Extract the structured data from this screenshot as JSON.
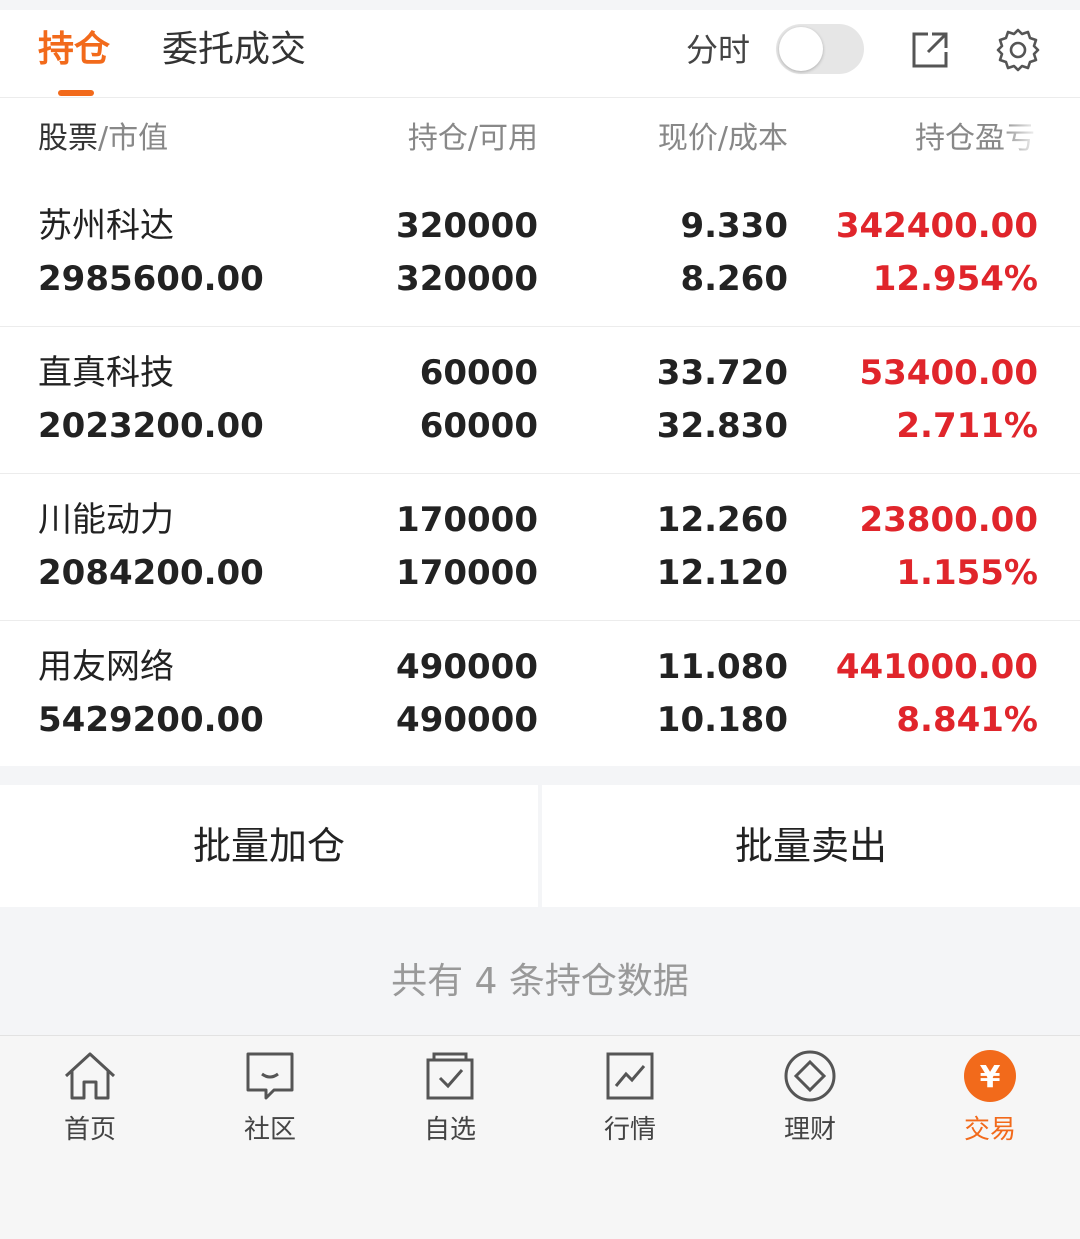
{
  "header": {
    "tab_positions": "持仓",
    "tab_orders": "委托成交",
    "fenshi_label": "分时",
    "fenshi_toggle_on": false
  },
  "columns": {
    "c1_main": "股票",
    "c1_sub": "/市值",
    "c2_main": "持仓",
    "c2_sub": "/可用",
    "c3_main": "现价",
    "c3_sub": "/成本",
    "c4_main": "持仓盈亏"
  },
  "holdings": [
    {
      "name": "苏州科达",
      "market_value": "2985600.00",
      "quantity": "320000",
      "available": "320000",
      "price": "9.330",
      "cost": "8.260",
      "pl_amount": "342400.00",
      "pl_percent": "12.954%"
    },
    {
      "name": "直真科技",
      "market_value": "2023200.00",
      "quantity": "60000",
      "available": "60000",
      "price": "33.720",
      "cost": "32.830",
      "pl_amount": "53400.00",
      "pl_percent": "2.711%"
    },
    {
      "name": "川能动力",
      "market_value": "2084200.00",
      "quantity": "170000",
      "available": "170000",
      "price": "12.260",
      "cost": "12.120",
      "pl_amount": "23800.00",
      "pl_percent": "1.155%"
    },
    {
      "name": "用友网络",
      "market_value": "5429200.00",
      "quantity": "490000",
      "available": "490000",
      "price": "11.080",
      "cost": "10.180",
      "pl_amount": "441000.00",
      "pl_percent": "8.841%"
    }
  ],
  "actions": {
    "batch_add": "批量加仓",
    "batch_sell": "批量卖出"
  },
  "summary": "共有 4 条持仓数据",
  "nav": {
    "home": "首页",
    "community": "社区",
    "watchlist": "自选",
    "market": "行情",
    "wealth": "理财",
    "trade": "交易",
    "trade_symbol": "¥"
  },
  "colors": {
    "accent": "#f26a1b",
    "gain": "#e0252b"
  },
  "icons": [
    "share-icon",
    "gear-icon",
    "home-icon",
    "chat-icon",
    "watchlist-icon",
    "chart-icon",
    "diamond-icon",
    "yen-icon"
  ]
}
